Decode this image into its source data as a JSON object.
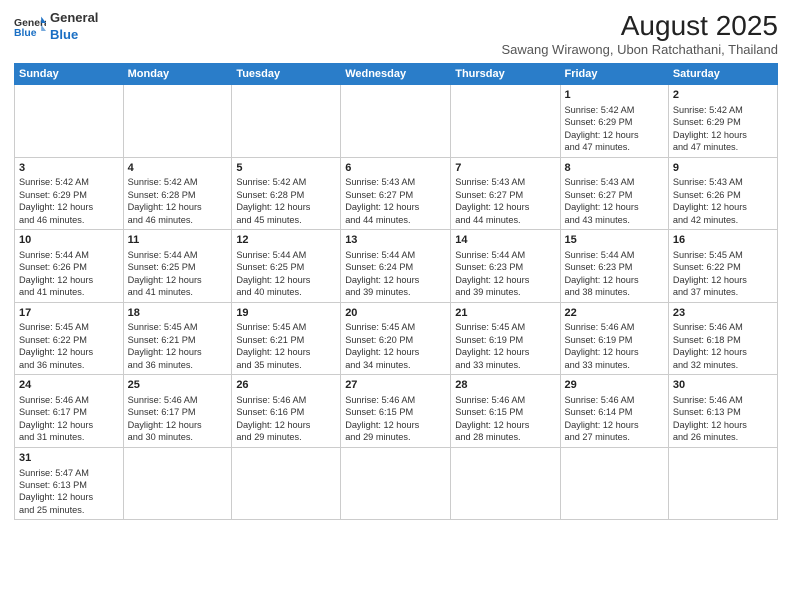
{
  "header": {
    "logo_general": "General",
    "logo_blue": "Blue",
    "month_title": "August 2025",
    "location": "Sawang Wirawong, Ubon Ratchathani, Thailand"
  },
  "weekdays": [
    "Sunday",
    "Monday",
    "Tuesday",
    "Wednesday",
    "Thursday",
    "Friday",
    "Saturday"
  ],
  "weeks": [
    [
      {
        "day": "",
        "info": ""
      },
      {
        "day": "",
        "info": ""
      },
      {
        "day": "",
        "info": ""
      },
      {
        "day": "",
        "info": ""
      },
      {
        "day": "",
        "info": ""
      },
      {
        "day": "1",
        "info": "Sunrise: 5:42 AM\nSunset: 6:29 PM\nDaylight: 12 hours\nand 47 minutes."
      },
      {
        "day": "2",
        "info": "Sunrise: 5:42 AM\nSunset: 6:29 PM\nDaylight: 12 hours\nand 47 minutes."
      }
    ],
    [
      {
        "day": "3",
        "info": "Sunrise: 5:42 AM\nSunset: 6:29 PM\nDaylight: 12 hours\nand 46 minutes."
      },
      {
        "day": "4",
        "info": "Sunrise: 5:42 AM\nSunset: 6:28 PM\nDaylight: 12 hours\nand 46 minutes."
      },
      {
        "day": "5",
        "info": "Sunrise: 5:42 AM\nSunset: 6:28 PM\nDaylight: 12 hours\nand 45 minutes."
      },
      {
        "day": "6",
        "info": "Sunrise: 5:43 AM\nSunset: 6:27 PM\nDaylight: 12 hours\nand 44 minutes."
      },
      {
        "day": "7",
        "info": "Sunrise: 5:43 AM\nSunset: 6:27 PM\nDaylight: 12 hours\nand 44 minutes."
      },
      {
        "day": "8",
        "info": "Sunrise: 5:43 AM\nSunset: 6:27 PM\nDaylight: 12 hours\nand 43 minutes."
      },
      {
        "day": "9",
        "info": "Sunrise: 5:43 AM\nSunset: 6:26 PM\nDaylight: 12 hours\nand 42 minutes."
      }
    ],
    [
      {
        "day": "10",
        "info": "Sunrise: 5:44 AM\nSunset: 6:26 PM\nDaylight: 12 hours\nand 41 minutes."
      },
      {
        "day": "11",
        "info": "Sunrise: 5:44 AM\nSunset: 6:25 PM\nDaylight: 12 hours\nand 41 minutes."
      },
      {
        "day": "12",
        "info": "Sunrise: 5:44 AM\nSunset: 6:25 PM\nDaylight: 12 hours\nand 40 minutes."
      },
      {
        "day": "13",
        "info": "Sunrise: 5:44 AM\nSunset: 6:24 PM\nDaylight: 12 hours\nand 39 minutes."
      },
      {
        "day": "14",
        "info": "Sunrise: 5:44 AM\nSunset: 6:23 PM\nDaylight: 12 hours\nand 39 minutes."
      },
      {
        "day": "15",
        "info": "Sunrise: 5:44 AM\nSunset: 6:23 PM\nDaylight: 12 hours\nand 38 minutes."
      },
      {
        "day": "16",
        "info": "Sunrise: 5:45 AM\nSunset: 6:22 PM\nDaylight: 12 hours\nand 37 minutes."
      }
    ],
    [
      {
        "day": "17",
        "info": "Sunrise: 5:45 AM\nSunset: 6:22 PM\nDaylight: 12 hours\nand 36 minutes."
      },
      {
        "day": "18",
        "info": "Sunrise: 5:45 AM\nSunset: 6:21 PM\nDaylight: 12 hours\nand 36 minutes."
      },
      {
        "day": "19",
        "info": "Sunrise: 5:45 AM\nSunset: 6:21 PM\nDaylight: 12 hours\nand 35 minutes."
      },
      {
        "day": "20",
        "info": "Sunrise: 5:45 AM\nSunset: 6:20 PM\nDaylight: 12 hours\nand 34 minutes."
      },
      {
        "day": "21",
        "info": "Sunrise: 5:45 AM\nSunset: 6:19 PM\nDaylight: 12 hours\nand 33 minutes."
      },
      {
        "day": "22",
        "info": "Sunrise: 5:46 AM\nSunset: 6:19 PM\nDaylight: 12 hours\nand 33 minutes."
      },
      {
        "day": "23",
        "info": "Sunrise: 5:46 AM\nSunset: 6:18 PM\nDaylight: 12 hours\nand 32 minutes."
      }
    ],
    [
      {
        "day": "24",
        "info": "Sunrise: 5:46 AM\nSunset: 6:17 PM\nDaylight: 12 hours\nand 31 minutes."
      },
      {
        "day": "25",
        "info": "Sunrise: 5:46 AM\nSunset: 6:17 PM\nDaylight: 12 hours\nand 30 minutes."
      },
      {
        "day": "26",
        "info": "Sunrise: 5:46 AM\nSunset: 6:16 PM\nDaylight: 12 hours\nand 29 minutes."
      },
      {
        "day": "27",
        "info": "Sunrise: 5:46 AM\nSunset: 6:15 PM\nDaylight: 12 hours\nand 29 minutes."
      },
      {
        "day": "28",
        "info": "Sunrise: 5:46 AM\nSunset: 6:15 PM\nDaylight: 12 hours\nand 28 minutes."
      },
      {
        "day": "29",
        "info": "Sunrise: 5:46 AM\nSunset: 6:14 PM\nDaylight: 12 hours\nand 27 minutes."
      },
      {
        "day": "30",
        "info": "Sunrise: 5:46 AM\nSunset: 6:13 PM\nDaylight: 12 hours\nand 26 minutes."
      }
    ],
    [
      {
        "day": "31",
        "info": "Sunrise: 5:47 AM\nSunset: 6:13 PM\nDaylight: 12 hours\nand 25 minutes."
      },
      {
        "day": "",
        "info": ""
      },
      {
        "day": "",
        "info": ""
      },
      {
        "day": "",
        "info": ""
      },
      {
        "day": "",
        "info": ""
      },
      {
        "day": "",
        "info": ""
      },
      {
        "day": "",
        "info": ""
      }
    ]
  ]
}
